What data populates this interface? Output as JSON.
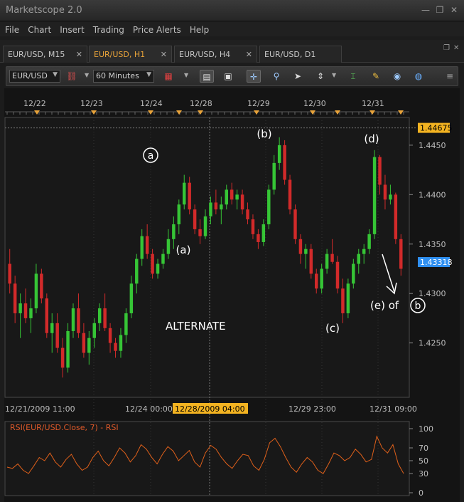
{
  "window": {
    "title": "Marketscope 2.0",
    "minimize": "—",
    "restore": "❐",
    "close": "✕"
  },
  "menu": [
    "File",
    "Chart",
    "Insert",
    "Trading",
    "Price Alerts",
    "Help"
  ],
  "tabs": [
    {
      "label": "EUR/USD, M15",
      "active": false
    },
    {
      "label": "EUR/USD, H1",
      "active": true
    },
    {
      "label": "EUR/USD, H4",
      "active": false
    },
    {
      "label": "EUR/USD, D1",
      "active": false
    }
  ],
  "toolbar": {
    "symbol": "EUR/USD",
    "timeframe": "60 Minutes"
  },
  "chart_data": {
    "type": "candlestick",
    "instrument": "EUR/USD",
    "timeframe": "H1",
    "date_labels": [
      "12/22",
      "12/23",
      "12/24",
      "12/28",
      "12/29",
      "12/30",
      "12/31"
    ],
    "x_labels": [
      "12/21/2009 11:00",
      "12/24 00:00",
      "12/29 23:00",
      "12/31 09:00"
    ],
    "crosshair_label": "12/28/2009 04:00",
    "y_ticks": [
      "1.4450",
      "1.4400",
      "1.4350",
      "1.4300",
      "1.4250"
    ],
    "ylim": [
      1.4195,
      1.4478
    ],
    "price_high_label": "1.44675",
    "price_current_label": "1.43318",
    "price_high": 1.44675,
    "price_current": 1.43318,
    "annotations": [
      {
        "label": "a",
        "circled": true,
        "price": 1.4435
      },
      {
        "label": "(a)",
        "circled": false,
        "price": 1.4345
      },
      {
        "label": "(b)",
        "circled": false,
        "price": 1.4458
      },
      {
        "label": "(c)",
        "circled": false,
        "price": 1.4262
      },
      {
        "label": "(d)",
        "circled": false,
        "price": 1.4452
      },
      {
        "label": "(e) of",
        "circled": false,
        "price": 1.4287
      },
      {
        "label": "b",
        "circled": true,
        "price": 1.4287
      }
    ],
    "note": "ALTERNATE",
    "candles": [
      [
        1.433,
        1.4345,
        1.43,
        1.431
      ],
      [
        1.431,
        1.4318,
        1.427,
        1.428
      ],
      [
        1.428,
        1.43,
        1.4255,
        1.429
      ],
      [
        1.429,
        1.4305,
        1.427,
        1.4275
      ],
      [
        1.4275,
        1.4295,
        1.426,
        1.4285
      ],
      [
        1.4285,
        1.433,
        1.428,
        1.432
      ],
      [
        1.432,
        1.4325,
        1.429,
        1.4295
      ],
      [
        1.4295,
        1.43,
        1.4255,
        1.426
      ],
      [
        1.426,
        1.428,
        1.424,
        1.427
      ],
      [
        1.427,
        1.428,
        1.424,
        1.4245
      ],
      [
        1.4245,
        1.4255,
        1.4215,
        1.4225
      ],
      [
        1.4225,
        1.427,
        1.422,
        1.4262
      ],
      [
        1.4262,
        1.429,
        1.4255,
        1.4285
      ],
      [
        1.4285,
        1.43,
        1.4255,
        1.426
      ],
      [
        1.426,
        1.427,
        1.4235,
        1.424
      ],
      [
        1.424,
        1.4262,
        1.4228,
        1.4255
      ],
      [
        1.4255,
        1.4275,
        1.4245,
        1.427
      ],
      [
        1.427,
        1.429,
        1.4262,
        1.4285
      ],
      [
        1.4285,
        1.43,
        1.4262,
        1.4265
      ],
      [
        1.4265,
        1.427,
        1.424,
        1.425
      ],
      [
        1.425,
        1.4255,
        1.4235,
        1.4242
      ],
      [
        1.4242,
        1.4265,
        1.4235,
        1.4258
      ],
      [
        1.4258,
        1.4285,
        1.425,
        1.428
      ],
      [
        1.428,
        1.4318,
        1.4275,
        1.431
      ],
      [
        1.431,
        1.434,
        1.43,
        1.4335
      ],
      [
        1.4335,
        1.4365,
        1.4328,
        1.4358
      ],
      [
        1.4358,
        1.437,
        1.4335,
        1.434
      ],
      [
        1.434,
        1.4345,
        1.4315,
        1.432
      ],
      [
        1.432,
        1.4335,
        1.4315,
        1.433
      ],
      [
        1.433,
        1.4345,
        1.4325,
        1.434
      ],
      [
        1.434,
        1.4365,
        1.4335,
        1.4355
      ],
      [
        1.4355,
        1.4378,
        1.4345,
        1.437
      ],
      [
        1.437,
        1.4395,
        1.436,
        1.439
      ],
      [
        1.439,
        1.442,
        1.4385,
        1.4412
      ],
      [
        1.4412,
        1.4418,
        1.438,
        1.4385
      ],
      [
        1.4385,
        1.439,
        1.436,
        1.4365
      ],
      [
        1.4365,
        1.4375,
        1.435,
        1.4358
      ],
      [
        1.4358,
        1.4385,
        1.4355,
        1.4378
      ],
      [
        1.4378,
        1.4398,
        1.437,
        1.4392
      ],
      [
        1.4392,
        1.4405,
        1.438,
        1.4385
      ],
      [
        1.4385,
        1.4398,
        1.437,
        1.439
      ],
      [
        1.439,
        1.441,
        1.4385,
        1.4405
      ],
      [
        1.4405,
        1.4412,
        1.439,
        1.4395
      ],
      [
        1.4395,
        1.4405,
        1.4385,
        1.44
      ],
      [
        1.44,
        1.4405,
        1.438,
        1.4385
      ],
      [
        1.4385,
        1.4392,
        1.437,
        1.4375
      ],
      [
        1.4375,
        1.438,
        1.4355,
        1.436
      ],
      [
        1.436,
        1.4365,
        1.4345,
        1.4352
      ],
      [
        1.4352,
        1.4375,
        1.4348,
        1.437
      ],
      [
        1.437,
        1.441,
        1.4365,
        1.4405
      ],
      [
        1.4405,
        1.444,
        1.44,
        1.4432
      ],
      [
        1.4432,
        1.4458,
        1.4425,
        1.445
      ],
      [
        1.445,
        1.4455,
        1.441,
        1.4415
      ],
      [
        1.4415,
        1.442,
        1.438,
        1.4385
      ],
      [
        1.4385,
        1.439,
        1.435,
        1.4355
      ],
      [
        1.4355,
        1.436,
        1.433,
        1.434
      ],
      [
        1.434,
        1.435,
        1.4325,
        1.4345
      ],
      [
        1.4345,
        1.435,
        1.4315,
        1.432
      ],
      [
        1.432,
        1.4325,
        1.43,
        1.4305
      ],
      [
        1.4305,
        1.433,
        1.43,
        1.4325
      ],
      [
        1.4325,
        1.4345,
        1.432,
        1.434
      ],
      [
        1.434,
        1.4355,
        1.433,
        1.4332
      ],
      [
        1.4332,
        1.4338,
        1.43,
        1.4305
      ],
      [
        1.4305,
        1.4315,
        1.427,
        1.428
      ],
      [
        1.428,
        1.4315,
        1.4275,
        1.431
      ],
      [
        1.431,
        1.4335,
        1.4305,
        1.433
      ],
      [
        1.433,
        1.4345,
        1.432,
        1.434
      ],
      [
        1.434,
        1.435,
        1.433,
        1.4345
      ],
      [
        1.4345,
        1.4365,
        1.434,
        1.436
      ],
      [
        1.436,
        1.4445,
        1.4355,
        1.4438
      ],
      [
        1.4438,
        1.444,
        1.44,
        1.441
      ],
      [
        1.441,
        1.442,
        1.4385,
        1.4395
      ],
      [
        1.4395,
        1.441,
        1.439,
        1.44
      ],
      [
        1.44,
        1.4402,
        1.435,
        1.4355
      ],
      [
        1.4355,
        1.436,
        1.4318,
        1.4325
      ]
    ],
    "rsi": {
      "title": "RSI(EUR/USD.Close, 7) - RSI",
      "y_ticks": [
        "100",
        "70",
        "50",
        "30",
        "0"
      ],
      "ylim": [
        0,
        100
      ],
      "values": [
        40,
        38,
        45,
        35,
        30,
        42,
        55,
        50,
        62,
        48,
        40,
        52,
        60,
        45,
        35,
        40,
        55,
        65,
        50,
        42,
        55,
        70,
        62,
        48,
        58,
        75,
        68,
        55,
        45,
        60,
        72,
        65,
        50,
        58,
        66,
        48,
        40,
        62,
        74,
        68,
        55,
        45,
        38,
        50,
        60,
        58,
        42,
        35,
        52,
        78,
        85,
        72,
        55,
        40,
        32,
        45,
        55,
        48,
        35,
        30,
        45,
        62,
        58,
        50,
        55,
        68,
        60,
        48,
        52,
        88,
        70,
        62,
        75,
        45,
        30
      ]
    }
  }
}
